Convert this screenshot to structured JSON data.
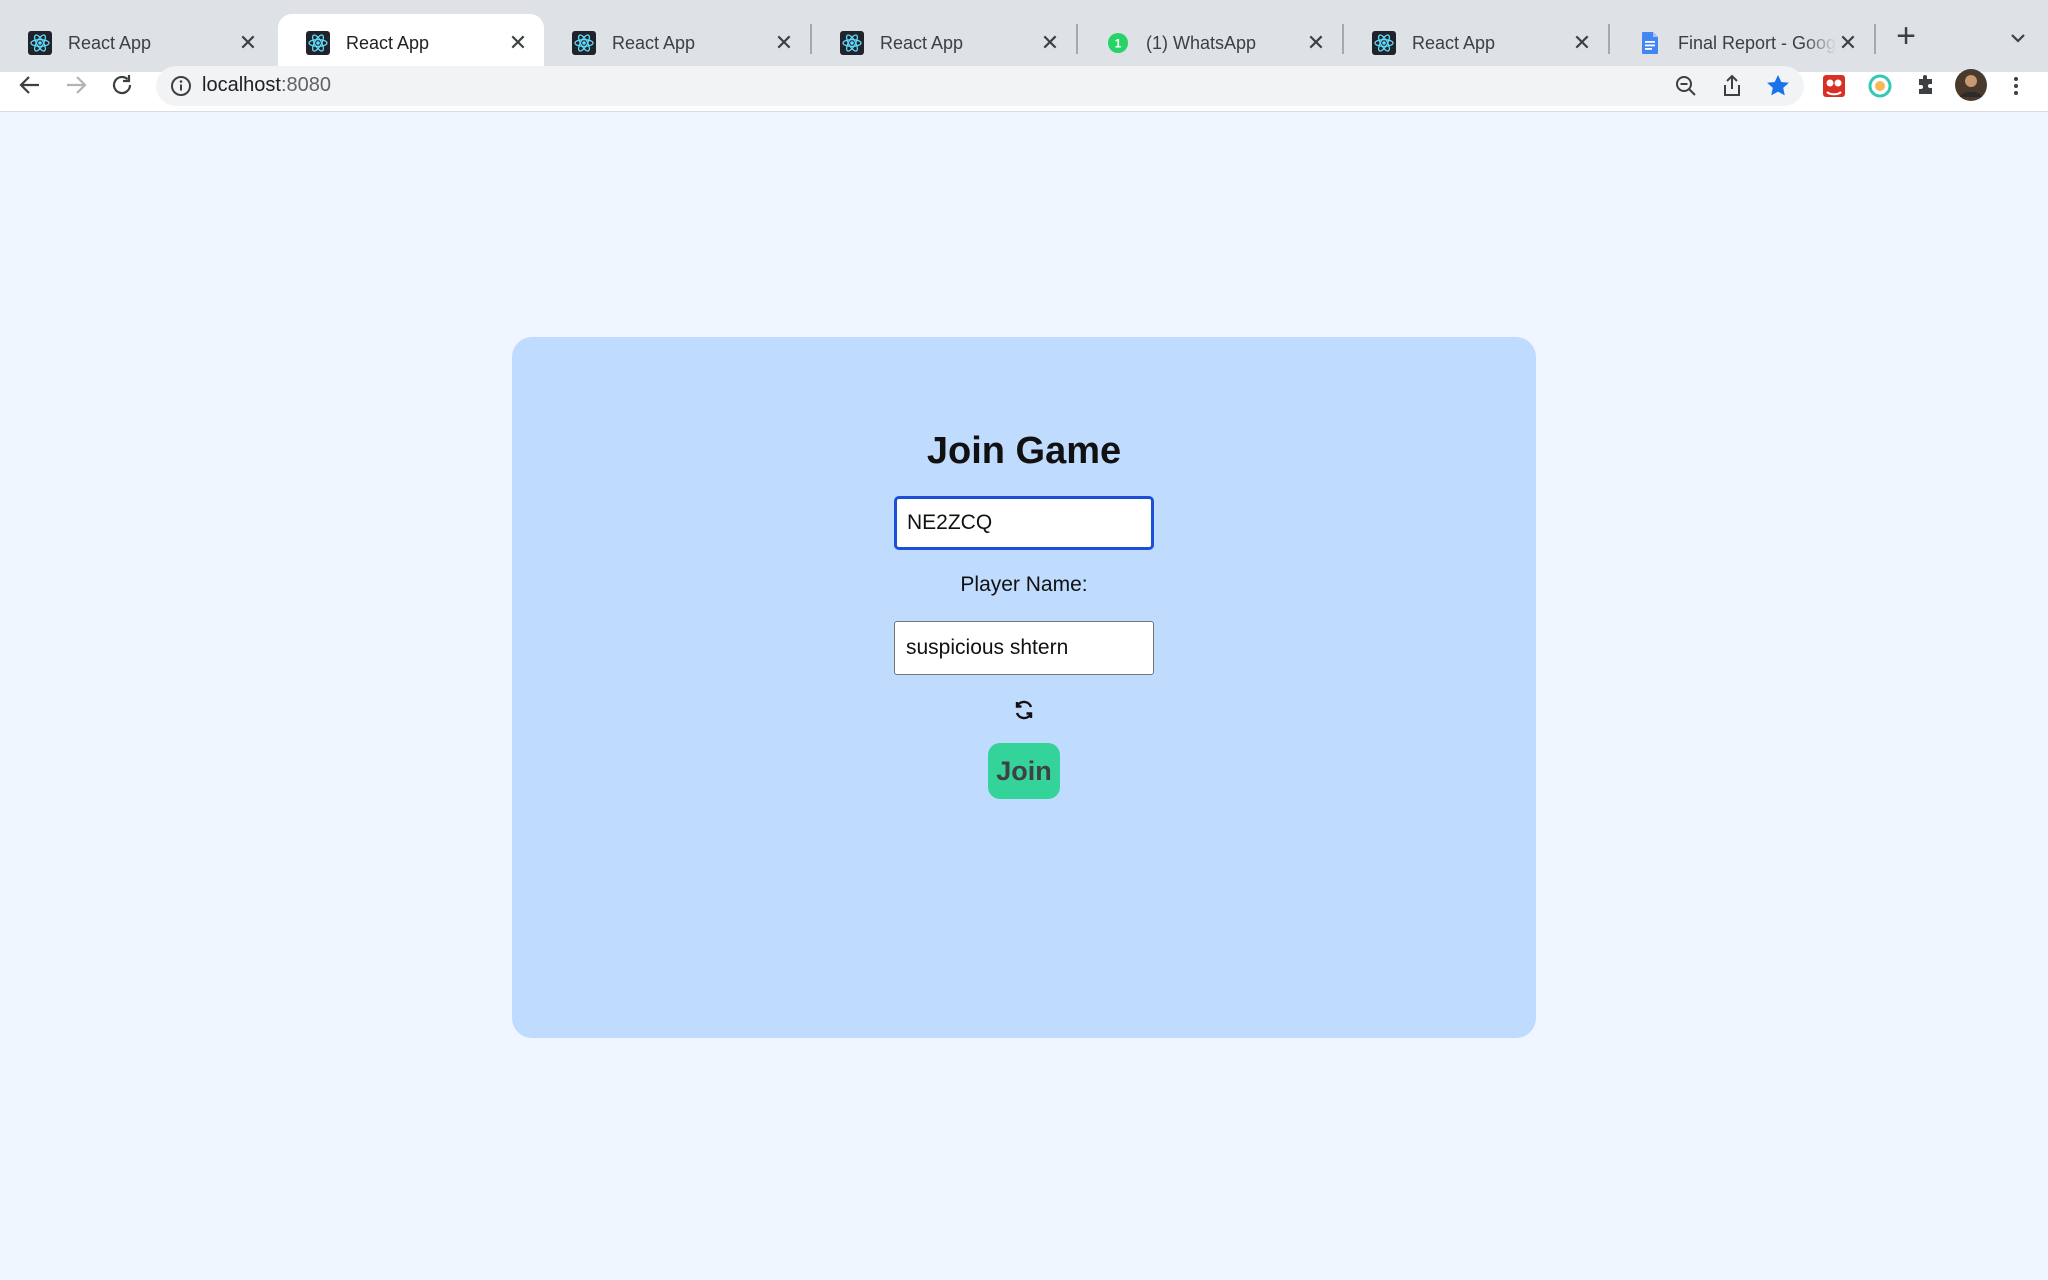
{
  "browser": {
    "tabs": [
      {
        "title": "React App",
        "favicon": "react-icon"
      },
      {
        "title": "React App",
        "favicon": "react-icon",
        "active": true
      },
      {
        "title": "React App",
        "favicon": "react-icon"
      },
      {
        "title": "React App",
        "favicon": "react-icon"
      },
      {
        "title": "(1) WhatsApp",
        "favicon": "whatsapp-icon",
        "badge": "1"
      },
      {
        "title": "React App",
        "favicon": "react-icon"
      },
      {
        "title": "Final Report - Google",
        "favicon": "google-docs-icon"
      }
    ],
    "url": {
      "host": "localhost",
      "port": ":8080"
    },
    "colors": {
      "tabstrip": "#dee1e6",
      "star": "#1a73e8"
    }
  },
  "page": {
    "title": "Join Game",
    "game_code": {
      "value": "NE2ZCQ"
    },
    "player_name_label": "Player Name:",
    "player_name": {
      "value": "suspicious shtern"
    },
    "join_label": "Join",
    "colors": {
      "background": "#eff6ff",
      "card": "#bfdbfe",
      "join_button": "#34d399",
      "focus_border": "#1d4ed8"
    }
  }
}
